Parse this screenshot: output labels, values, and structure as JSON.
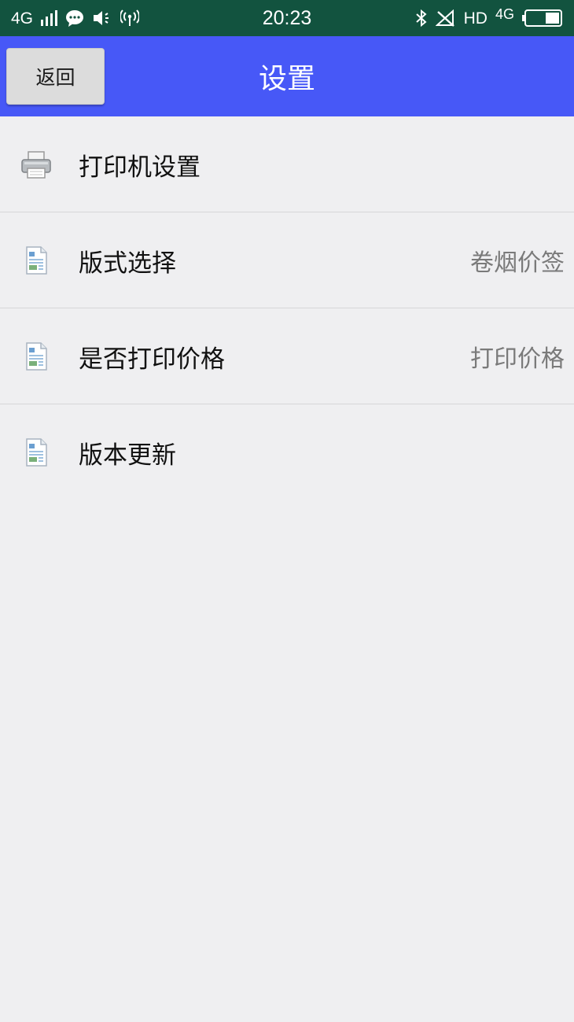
{
  "status_bar": {
    "network": "4G",
    "time": "20:23",
    "hd": "HD",
    "network_right": "4G",
    "icons": [
      "signal-icon",
      "message-icon",
      "volume-icon",
      "hotspot-icon",
      "bluetooth-icon",
      "wifi-off-icon",
      "battery-icon"
    ]
  },
  "header": {
    "back_label": "返回",
    "title": "设置",
    "color": "#4758f7"
  },
  "settings": {
    "items": [
      {
        "label": "打印机设置",
        "value": "",
        "icon": "printer-icon"
      },
      {
        "label": "版式选择",
        "value": "卷烟价签",
        "icon": "document-icon"
      },
      {
        "label": "是否打印价格",
        "value": "打印价格",
        "icon": "document-icon"
      },
      {
        "label": "版本更新",
        "value": "",
        "icon": "document-icon"
      }
    ]
  }
}
